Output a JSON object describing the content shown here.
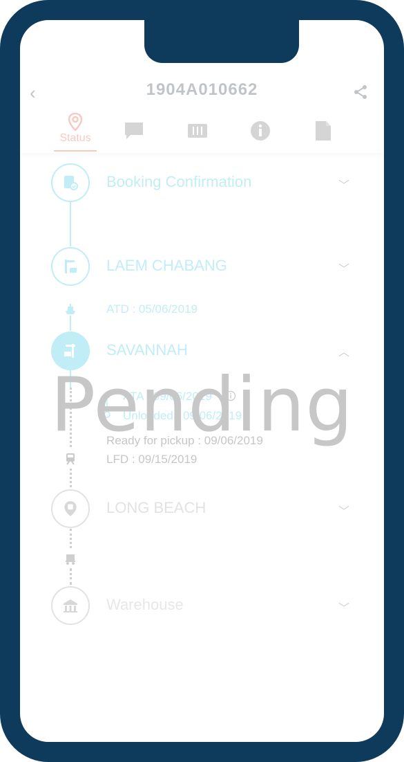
{
  "header": {
    "title": "1904A010662"
  },
  "tabs": [
    {
      "label": "Status",
      "active": true,
      "icon": "location-pin-icon"
    },
    {
      "label": "",
      "icon": "chat-icon"
    },
    {
      "label": "",
      "icon": "container-icon"
    },
    {
      "label": "",
      "icon": "info-icon"
    },
    {
      "label": "",
      "icon": "document-icon"
    }
  ],
  "timeline": {
    "booking": {
      "name": "Booking Confirmation"
    },
    "origin": {
      "name": "LAEM CHABANG",
      "detail": "ATD : 05/06/2019"
    },
    "destination": {
      "name": "SAVANNAH",
      "ata": "ATA : 09/06/2019",
      "unloaded": "Unloaded : 09/06/2019",
      "ready": "Ready for pickup : 09/06/2019",
      "lfd": "LFD : 09/15/2019"
    },
    "rail": {
      "name": "LONG BEACH"
    },
    "warehouse": {
      "name": "Warehouse"
    }
  },
  "colors": {
    "accent": "#e8402c",
    "cyan": "#1fc0e0",
    "frame": "#0e3a5c"
  },
  "overlay": {
    "text": "Pending"
  }
}
